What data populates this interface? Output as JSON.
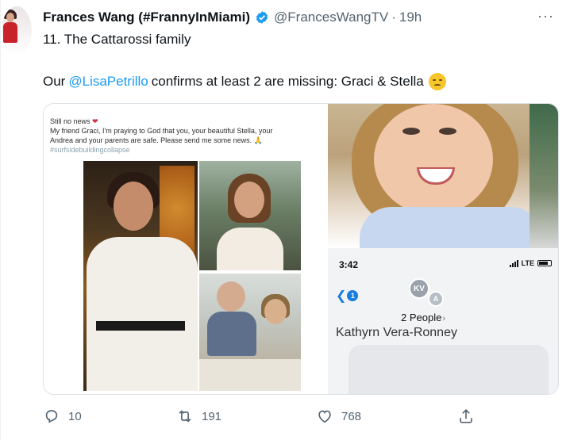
{
  "tweet": {
    "display_name": "Frances Wang (#FrannyInMiami)",
    "handle": "@FrancesWangTV",
    "separator": "·",
    "time": "19h",
    "more": "···",
    "line1": "11. The Cattarossi family",
    "line2_prefix": "Our",
    "mention": "@LisaPetrillo",
    "line2_suffix": "confirms at least 2 are missing: Graci & Stella",
    "emoji": "pensive-face-emoji",
    "accent_color": "#1d9bf0"
  },
  "media": {
    "card": {
      "line1": "Still no news",
      "line2": "My friend Graci, I'm praying to God that you, your beautiful Stella, your",
      "line3": "Andrea and your parents are safe. Please send me some news.",
      "hashtag": "#surfsidebuildingcollapse"
    },
    "phone": {
      "time": "3:42",
      "carrier": "LTE",
      "back_count": "1",
      "avatar_kv": "KV",
      "avatar_a": "A",
      "people": "2 People",
      "chevron": "›",
      "contact_name": "Kathyrn Vera-Ronney"
    }
  },
  "actions": {
    "reply_count": "10",
    "retweet_count": "191",
    "like_count": "768"
  }
}
